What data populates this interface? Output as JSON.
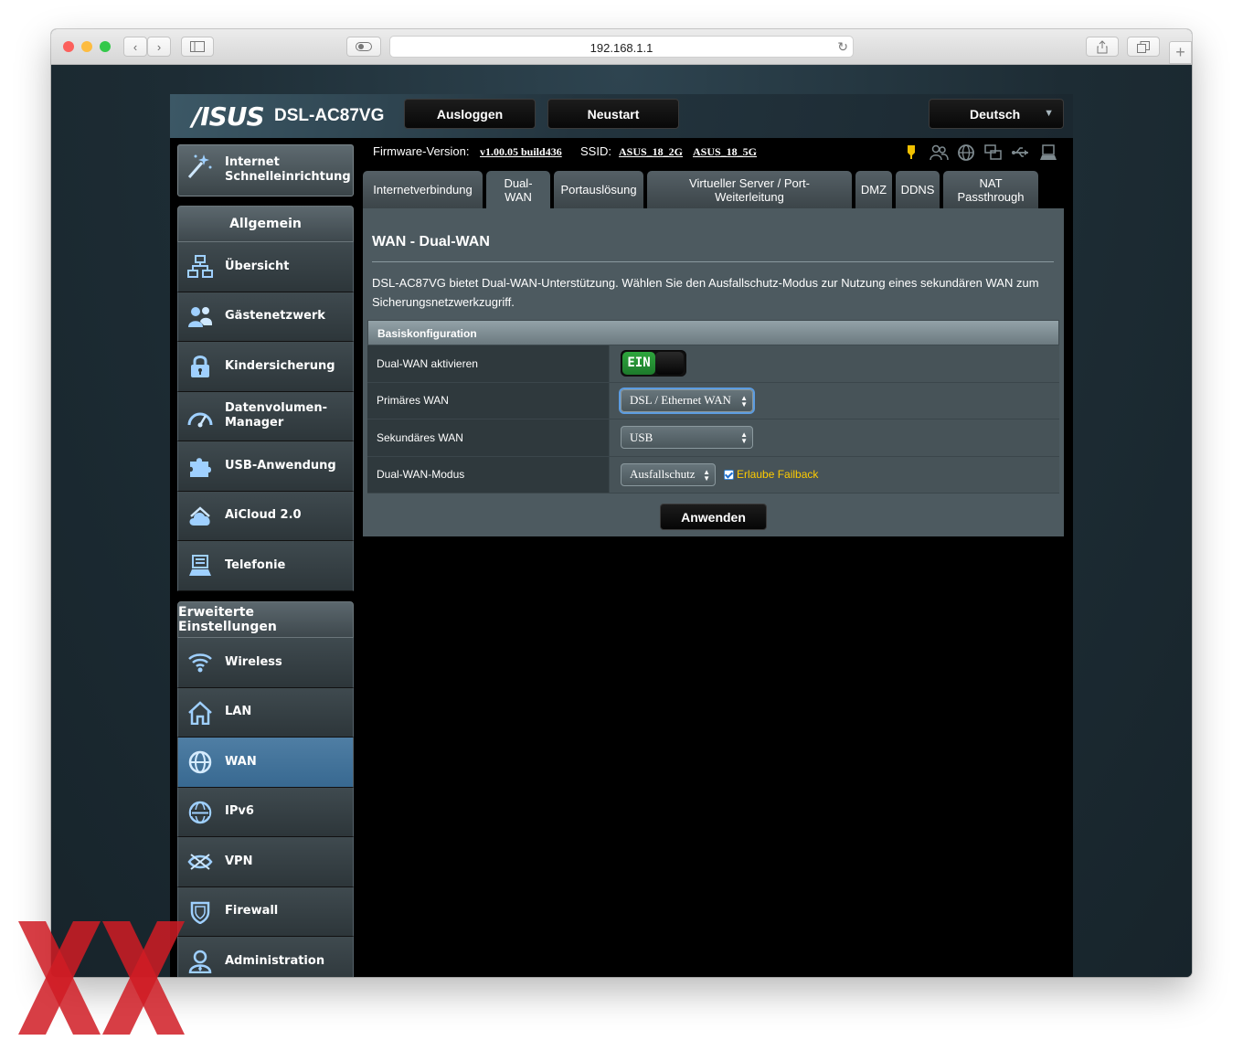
{
  "browser": {
    "url": "192.168.1.1",
    "colors": {
      "close": "#fc605c",
      "minimize": "#fdbc40",
      "maximize": "#34c84a"
    }
  },
  "header": {
    "brand": "/ISUS",
    "model": "DSL-AC87VG",
    "logout": "Ausloggen",
    "reboot": "Neustart",
    "language": "Deutsch"
  },
  "info_bar": {
    "firmware_label": "Firmware-Version:",
    "firmware_value": "v1.00.05 build436",
    "ssid_label": "SSID:",
    "ssid_1": "ASUS_18_2G",
    "ssid_2": "ASUS_18_5G"
  },
  "sidebar": {
    "quick_setup": "Internet Schnelleinrichtung",
    "general_title": "Allgemein",
    "general_items": [
      {
        "label": "Übersicht",
        "icon": "network-map-icon"
      },
      {
        "label": "Gästenetzwerk",
        "icon": "guest-network-icon"
      },
      {
        "label": "Kindersicherung",
        "icon": "parental-lock-icon"
      },
      {
        "label": "Datenvolumen-Manager",
        "icon": "speedometer-icon"
      },
      {
        "label": "USB-Anwendung",
        "icon": "puzzle-icon"
      },
      {
        "label": "AiCloud 2.0",
        "icon": "cloud-icon"
      },
      {
        "label": "Telefonie",
        "icon": "telephony-icon"
      }
    ],
    "advanced_title": "Erweiterte Einstellungen",
    "advanced_items": [
      {
        "label": "Wireless",
        "icon": "wifi-icon"
      },
      {
        "label": "LAN",
        "icon": "home-icon"
      },
      {
        "label": "WAN",
        "icon": "globe-icon",
        "active": true
      },
      {
        "label": "IPv6",
        "icon": "ipv6-globe-icon"
      },
      {
        "label": "VPN",
        "icon": "vpn-icon"
      },
      {
        "label": "Firewall",
        "icon": "shield-icon"
      },
      {
        "label": "Administration",
        "icon": "admin-user-icon"
      }
    ]
  },
  "tabs": [
    {
      "label": "Internetverbindung"
    },
    {
      "label": "Dual-WAN",
      "active": true
    },
    {
      "label": "Portauslösung"
    },
    {
      "label": "Virtueller Server / Port-Weiterleitung"
    },
    {
      "label": "DMZ"
    },
    {
      "label": "DDNS"
    },
    {
      "label": "NAT Passthrough"
    }
  ],
  "panel": {
    "title": "WAN - Dual-WAN",
    "description": "DSL-AC87VG bietet Dual-WAN-Unterstützung. Wählen Sie den Ausfallschutz-Modus zur Nutzung eines sekundären WAN zum Sicherungsnetzwerkzugriff.",
    "section_title": "Basiskonfiguration",
    "rows": {
      "enable_label": "Dual-WAN aktivieren",
      "enable_value": "EIN",
      "primary_label": "Primäres WAN",
      "primary_value": "DSL / Ethernet WAN",
      "secondary_label": "Sekundäres WAN",
      "secondary_value": "USB",
      "mode_label": "Dual-WAN-Modus",
      "mode_value": "Ausfallschutz",
      "failback_label": "Erlaube Failback",
      "failback_checked": true
    },
    "apply": "Anwenden"
  },
  "accent_colors": {
    "active_menu": "#386991",
    "toggle_on": "#2ea63d",
    "failback_text": "#ffcc00",
    "watermark": "#d01c24"
  }
}
